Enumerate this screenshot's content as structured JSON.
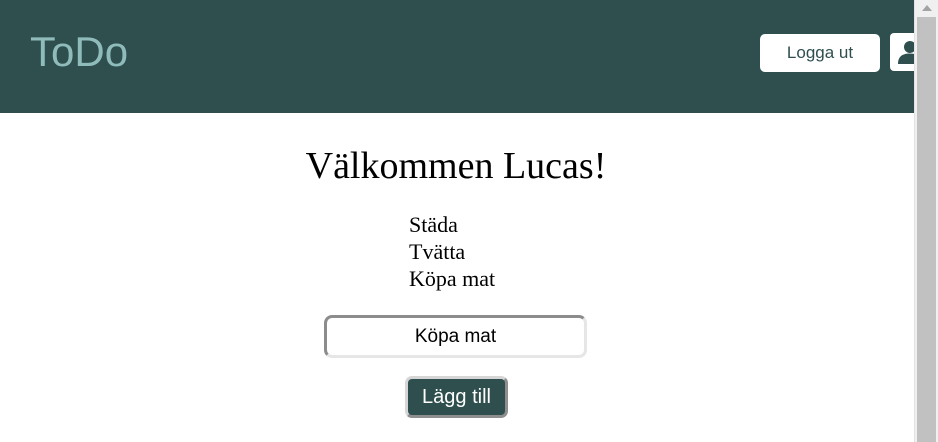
{
  "header": {
    "brand": "ToDo",
    "logout_label": "Logga ut",
    "profile_icon": "user-icon",
    "background_color": "#2f4f4f",
    "brand_color": "#8fbcbb"
  },
  "main": {
    "welcome": "Välkommen Lucas!",
    "todos": [
      "Städa",
      "Tvätta",
      "Köpa mat"
    ],
    "new_todo_value": "Köpa mat",
    "add_label": "Lägg till"
  }
}
